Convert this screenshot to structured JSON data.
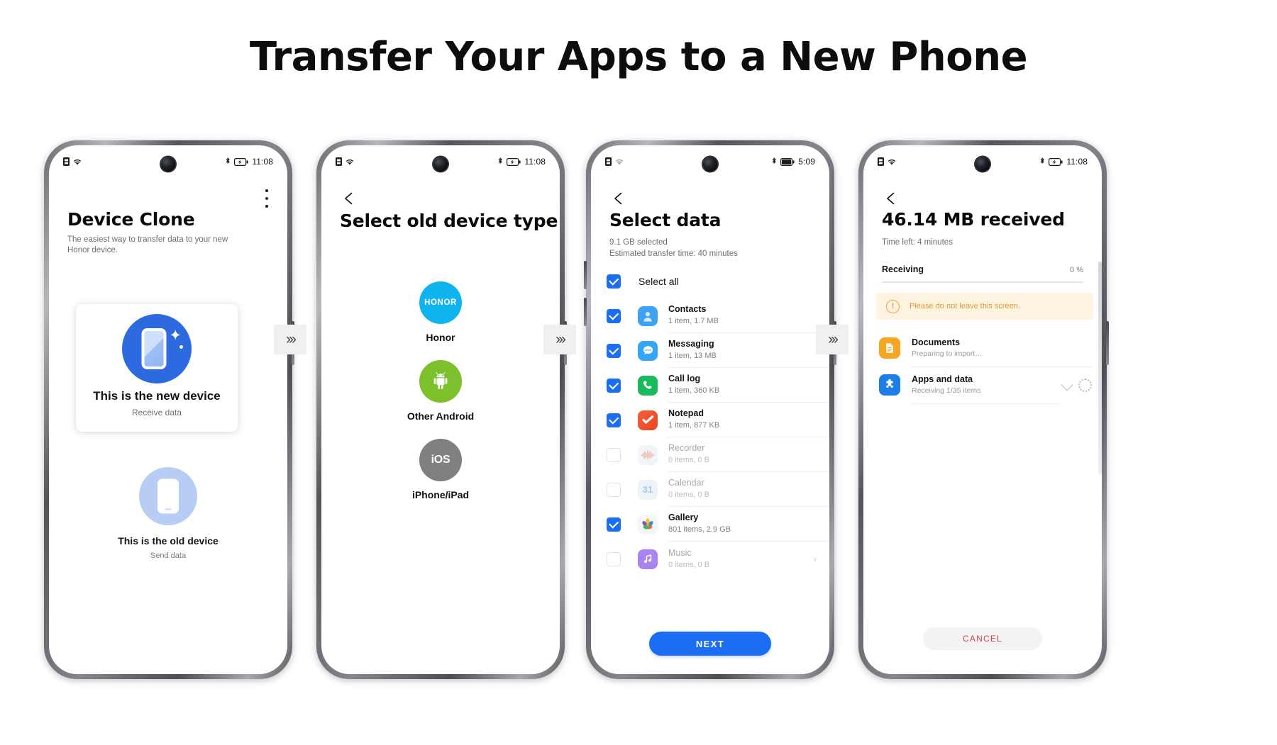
{
  "page": {
    "title": "Transfer Your Apps to a New Phone"
  },
  "arrow_glyph": "›››",
  "phones": [
    {
      "status": {
        "time": "11:08",
        "battery_icon": "battery-icon",
        "wifi_icon": "wifi-icon",
        "bluetooth_icon": "bluetooth-icon"
      },
      "title": "Device Clone",
      "subtitle": "The easiest way to transfer data to your new Honor device.",
      "menu_icon": "overflow-menu-icon",
      "new_device": {
        "title": "This is the new device",
        "subtitle": "Receive data",
        "icon": "new-phone-icon"
      },
      "old_device": {
        "title": "This is the old device",
        "subtitle": "Send data",
        "icon": "old-phone-icon"
      }
    },
    {
      "status": {
        "time": "11:08"
      },
      "title": "Select old device type",
      "back_icon": "back-arrow-icon",
      "options": [
        {
          "label": "Honor",
          "badge": "HONOR",
          "color": "#0fb4ef",
          "icon": "honor-logo-icon"
        },
        {
          "label": "Other Android",
          "badge": "",
          "color": "#7cc02b",
          "icon": "android-robot-icon"
        },
        {
          "label": "iPhone/iPad",
          "badge": "iOS",
          "color": "#808080",
          "icon": "ios-logo-icon"
        }
      ]
    },
    {
      "status": {
        "time": "5:09"
      },
      "title": "Select data",
      "back_icon": "back-arrow-icon",
      "selected_summary": "9.1 GB selected",
      "estimate": "Estimated transfer time: 40 minutes",
      "select_all_label": "Select all",
      "select_all_checked": true,
      "items": [
        {
          "name": "Contacts",
          "meta": "1 item, 1.7 MB",
          "checked": true,
          "icon": "contacts-icon",
          "color": "#3ea2f2"
        },
        {
          "name": "Messaging",
          "meta": "1 item, 13 MB",
          "checked": true,
          "icon": "messaging-icon",
          "color": "#34a6f5"
        },
        {
          "name": "Call log",
          "meta": "1 item, 360 KB",
          "checked": true,
          "icon": "phone-icon",
          "color": "#1ab95b"
        },
        {
          "name": "Notepad",
          "meta": "1 item, 877 KB",
          "checked": true,
          "icon": "notepad-icon",
          "color": "#f0502c"
        },
        {
          "name": "Recorder",
          "meta": "0 items, 0 B",
          "checked": false,
          "icon": "recorder-icon",
          "color": "#f1f4f8"
        },
        {
          "name": "Calendar",
          "meta": "0 items, 0 B",
          "checked": false,
          "icon": "calendar-icon",
          "color": "#eef3f9"
        },
        {
          "name": "Gallery",
          "meta": "801 items, 2.9 GB",
          "checked": true,
          "icon": "gallery-icon",
          "color": "#f4f6fa"
        },
        {
          "name": "Music",
          "meta": "0 items, 0 B",
          "checked": false,
          "icon": "music-icon",
          "color": "#a983f0"
        }
      ],
      "next_label": "NEXT"
    },
    {
      "status": {
        "time": "11:08"
      },
      "back_icon": "back-arrow-icon",
      "title": "46.14 MB received",
      "time_left": "Time left: 4 minutes",
      "progress_label": "Receiving",
      "progress_percent": "0 %",
      "warning": "Please do not leave this screen.",
      "warning_icon": "warning-exclamation-icon",
      "items": [
        {
          "name": "Documents",
          "meta": "Preparing to import…",
          "icon": "documents-icon",
          "color": "#f5a623",
          "spinner": false,
          "chevron": false
        },
        {
          "name": "Apps and data",
          "meta": "Receiving 1/35 items",
          "icon": "apps-puzzle-icon",
          "color": "#1d7ee8",
          "spinner": true,
          "chevron": true
        }
      ],
      "cancel_label": "CANCEL"
    }
  ]
}
